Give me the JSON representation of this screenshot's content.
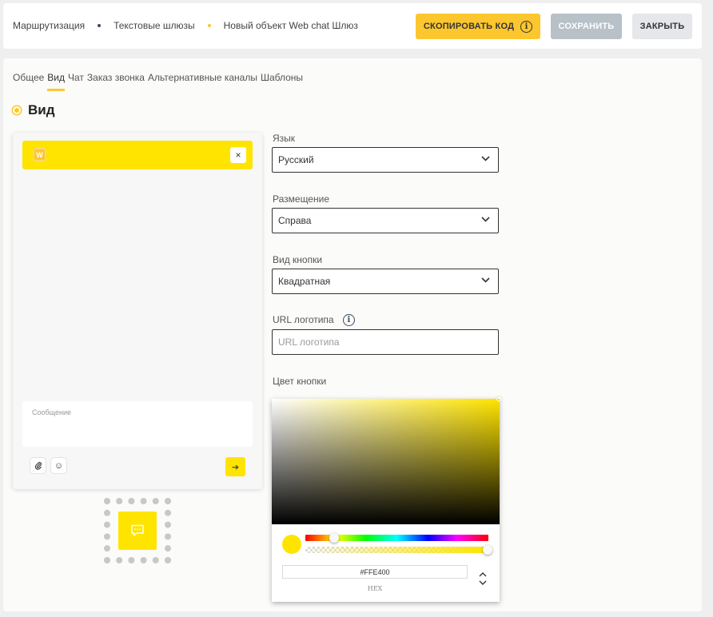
{
  "breadcrumbs": [
    {
      "label": "Маршрутизация"
    },
    {
      "label": "Текстовые шлюзы",
      "dot_color": "#3a4a64"
    },
    {
      "label": "Новый объект Web chat Шлюз",
      "dot_color": "#fcc72e"
    }
  ],
  "toolbar": {
    "copy_label": "СКОПИРОВАТЬ КОД",
    "save_label": "СОХРАНИТЬ",
    "close_label": "ЗАКРЫТЬ"
  },
  "tabs": [
    {
      "label": "Общее"
    },
    {
      "label": "Вид",
      "active": true
    },
    {
      "label": "Чат"
    },
    {
      "label": "Заказ звонка"
    },
    {
      "label": "Альтернативные каналы"
    },
    {
      "label": "Шаблоны"
    }
  ],
  "section": {
    "title": "Вид"
  },
  "preview": {
    "logo_letter": "W",
    "close_symbol": "×",
    "message_placeholder": "Сообщение",
    "send_symbol": "➔"
  },
  "fields": {
    "language": {
      "label": "Язык",
      "value": "Русский"
    },
    "placement": {
      "label": "Размещение",
      "value": "Справа"
    },
    "button_type": {
      "label": "Вид кнопки",
      "value": "Квадратная"
    },
    "logo_url": {
      "label": "URL логотипа",
      "placeholder": "URL логотипа"
    },
    "button_color": {
      "label": "Цвет кнопки"
    }
  },
  "color_picker": {
    "hex_value": "#FFE400",
    "mode_label": "HEX",
    "alpha": 1.0
  },
  "colors": {
    "accent": "#fcc72e",
    "chat_yellow": "#ffe400",
    "save_disabled": "#b8c0c8"
  },
  "icons": {
    "info": "i",
    "clip": "📎",
    "smile": "☺"
  }
}
